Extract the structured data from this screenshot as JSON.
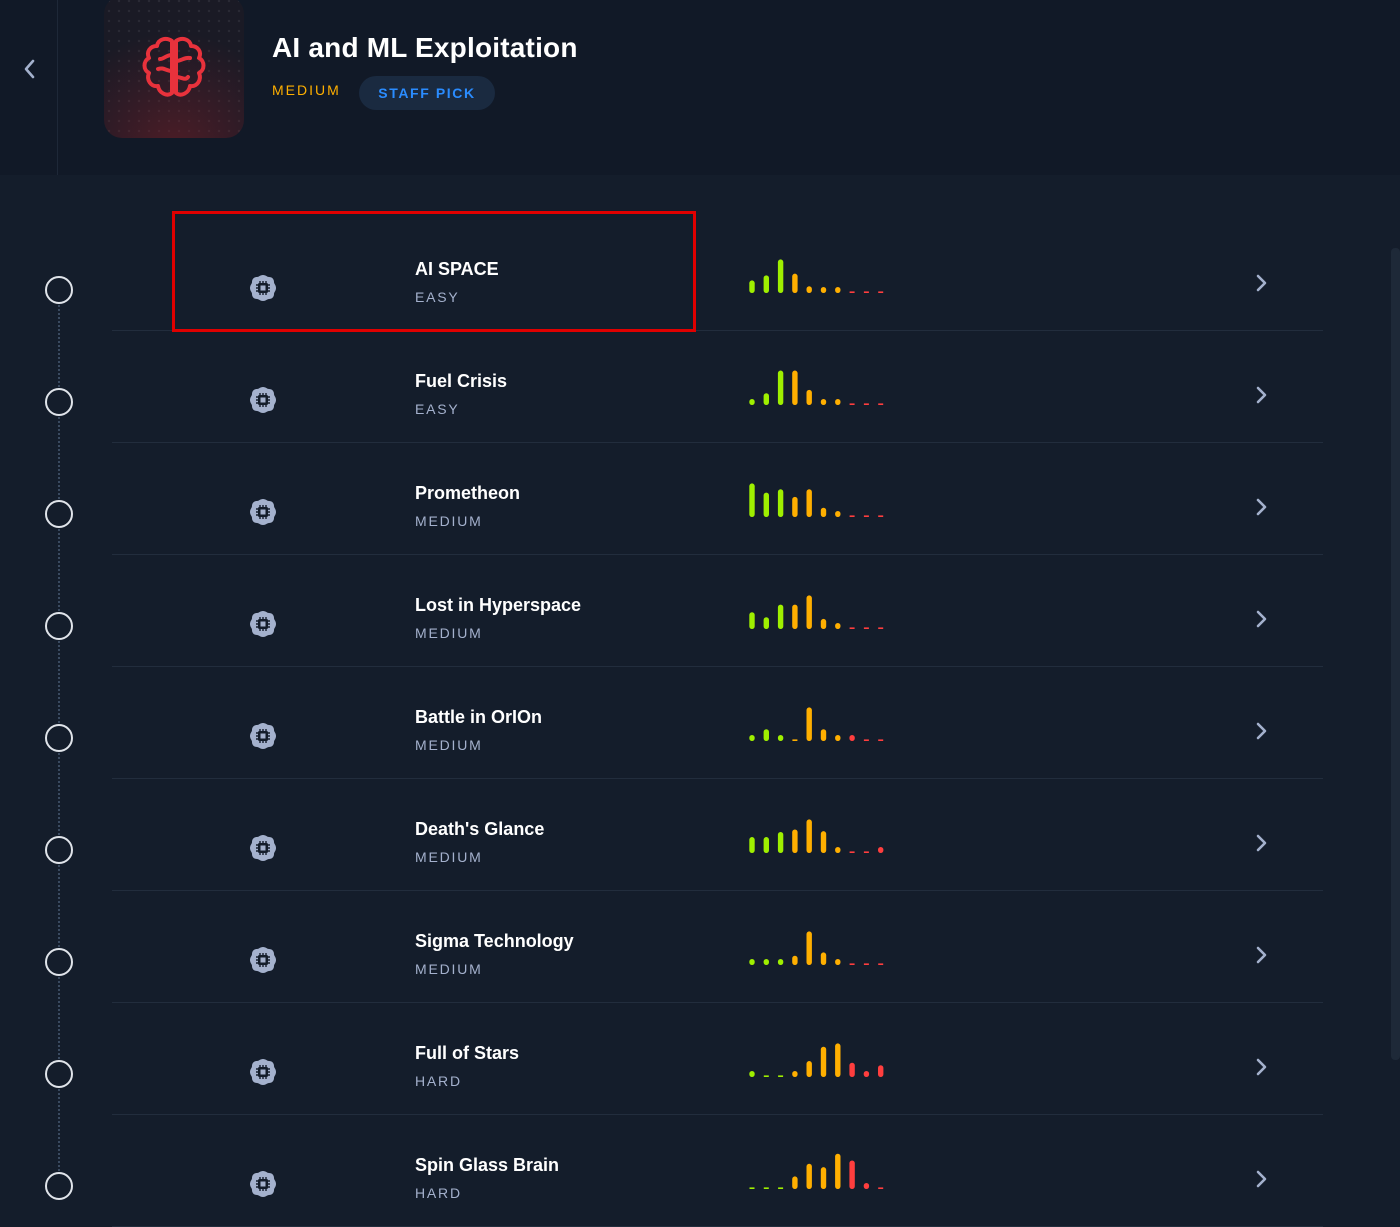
{
  "header": {
    "title": "AI and ML Exploitation",
    "difficulty": "MEDIUM",
    "badge": "STAFF PICK",
    "back_icon": "chevron-left-icon",
    "logo_icon": "brain-icon",
    "logo_color": "#e8323c"
  },
  "colors": {
    "background": "#141d2b",
    "header_background": "#111927",
    "difficulty_medium": "#ffaf00",
    "staff_pick_text": "#2a8cff",
    "rating_easy": "#9fef00",
    "rating_medium": "#ffaf00",
    "rating_hard": "#ff3e3e",
    "highlight_box": "#e00000"
  },
  "challenges": [
    {
      "name": "AI SPACE",
      "difficulty": "EASY",
      "rating": [
        0.3,
        0.42,
        0.8,
        0.46,
        0.16,
        0.07,
        0.03,
        0,
        0,
        0
      ],
      "icon": "ai-chip-icon"
    },
    {
      "name": "Fuel Crisis",
      "difficulty": "EASY",
      "rating": [
        0.06,
        0.28,
        0.82,
        0.82,
        0.36,
        0.09,
        0.04,
        0,
        0,
        0
      ],
      "icon": "ai-chip-icon"
    },
    {
      "name": "Prometheon",
      "difficulty": "MEDIUM",
      "rating": [
        0.8,
        0.58,
        0.66,
        0.48,
        0.66,
        0.22,
        0.05,
        0,
        0,
        0
      ],
      "icon": "ai-chip-icon"
    },
    {
      "name": "Lost in Hyperspace",
      "difficulty": "MEDIUM",
      "rating": [
        0.4,
        0.28,
        0.58,
        0.58,
        0.8,
        0.24,
        0.06,
        0,
        0,
        0
      ],
      "icon": "ai-chip-icon"
    },
    {
      "name": "Battle in OrIOn",
      "difficulty": "MEDIUM",
      "rating": [
        0.1,
        0.28,
        0.14,
        0,
        0.8,
        0.28,
        0.14,
        0.12,
        0,
        0
      ],
      "icon": "ai-chip-icon"
    },
    {
      "name": "Death's Glance",
      "difficulty": "MEDIUM",
      "rating": [
        0.38,
        0.38,
        0.5,
        0.56,
        0.8,
        0.52,
        0.12,
        0,
        0,
        0.12
      ],
      "icon": "ai-chip-icon"
    },
    {
      "name": "Sigma Technology",
      "difficulty": "MEDIUM",
      "rating": [
        0.04,
        0.07,
        0.14,
        0.22,
        0.8,
        0.3,
        0.12,
        0,
        0,
        0
      ],
      "icon": "ai-chip-icon"
    },
    {
      "name": "Full of Stars",
      "difficulty": "HARD",
      "rating": [
        0.14,
        0,
        0,
        0.1,
        0.38,
        0.72,
        0.8,
        0.34,
        0.12,
        0.28
      ],
      "icon": "ai-chip-icon"
    },
    {
      "name": "Spin Glass Brain",
      "difficulty": "HARD",
      "rating": [
        0,
        0,
        0,
        0.3,
        0.6,
        0.52,
        0.84,
        0.68,
        0.14,
        0
      ],
      "icon": "ai-chip-icon"
    }
  ]
}
